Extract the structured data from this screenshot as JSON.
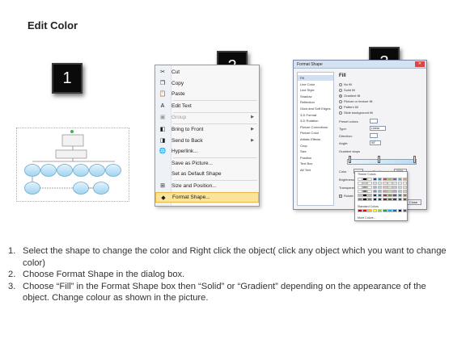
{
  "page": {
    "title": "Edit Color"
  },
  "badges": [
    "1",
    "2",
    "3"
  ],
  "context_menu": {
    "items": [
      {
        "label": "Cut",
        "icon": "scissors-icon",
        "glyph": "✂",
        "disabled": false,
        "submenu": false
      },
      {
        "label": "Copy",
        "icon": "copy-icon",
        "glyph": "❐",
        "disabled": false,
        "submenu": false
      },
      {
        "label": "Paste",
        "icon": "paste-icon",
        "glyph": "📋",
        "disabled": false,
        "submenu": false
      },
      {
        "label": "Edit Text",
        "icon": "edit-text-icon",
        "glyph": "A",
        "disabled": false,
        "submenu": false
      },
      {
        "label": "Group",
        "icon": "group-icon",
        "glyph": "▣",
        "disabled": true,
        "submenu": true
      },
      {
        "label": "Bring to Front",
        "icon": "bring-to-front-icon",
        "glyph": "◧",
        "disabled": false,
        "submenu": true
      },
      {
        "label": "Send to Back",
        "icon": "send-to-back-icon",
        "glyph": "◨",
        "disabled": false,
        "submenu": true
      },
      {
        "label": "Hyperlink...",
        "icon": "hyperlink-icon",
        "glyph": "🌐",
        "disabled": false,
        "submenu": false
      },
      {
        "label": "Save as Picture...",
        "icon": "",
        "glyph": "",
        "disabled": false,
        "submenu": false
      },
      {
        "label": "Set as Default Shape",
        "icon": "",
        "glyph": "",
        "disabled": false,
        "submenu": false
      },
      {
        "label": "Size and Position...",
        "icon": "size-position-icon",
        "glyph": "⊞",
        "disabled": false,
        "submenu": false
      },
      {
        "label": "Format Shape...",
        "icon": "format-shape-icon",
        "glyph": "◆",
        "disabled": false,
        "submenu": false,
        "selected": true
      }
    ]
  },
  "format_dialog": {
    "title": "Format Shape",
    "nav": [
      "Fill",
      "Line Color",
      "Line Style",
      "Shadow",
      "Reflection",
      "Glow and Soft Edges",
      "3-D Format",
      "3-D Rotation",
      "Picture Corrections",
      "Picture Color",
      "Artistic Effects",
      "Crop",
      "Size",
      "Position",
      "Text Box",
      "Alt Text"
    ],
    "pane_heading": "Fill",
    "fill_options": [
      "No fill",
      "Solid fill",
      "Gradient fill",
      "Picture or texture fill",
      "Pattern fill",
      "Slide background fill"
    ],
    "selected_fill": "Gradient fill",
    "fields": {
      "preset_colors": "Preset colors:",
      "type": "Type:",
      "type_value": "Linear",
      "direction": "Direction:",
      "angle": "Angle:",
      "angle_value": "90°",
      "gradient_stops": "Gradient stops",
      "color": "Color",
      "position": "Position:",
      "position_value": "100%",
      "brightness": "Brightness:",
      "transparency": "Transparency:",
      "rotate_with_shape": "Rotate with shape"
    },
    "buttons": {
      "close": "Close"
    }
  },
  "palette": {
    "theme_label": "Theme Colors",
    "standard_label": "Standard Colors",
    "more_label": "More Colors...",
    "theme_top": [
      "#ffffff",
      "#000000",
      "#eeece1",
      "#1f497d",
      "#4f81bd",
      "#c0504d",
      "#9bbb59",
      "#8064a2",
      "#4bacc6",
      "#f79646"
    ],
    "standard": [
      "#c00000",
      "#ff0000",
      "#ffc000",
      "#ffff00",
      "#92d050",
      "#00b050",
      "#00b0f0",
      "#0070c0",
      "#002060",
      "#7030a0"
    ]
  },
  "instructions": [
    {
      "num": "1.",
      "text": "Select the shape to change the color and Right click the object( click any object which you want to change color)"
    },
    {
      "num": "2.",
      "text": "Choose Format Shape in the dialog box."
    },
    {
      "num": "3.",
      "text": "Choose “Fill” in the Format Shape box then “Solid” or “Gradient” depending on the appearance of the object. Change colour as shown in the picture."
    }
  ]
}
